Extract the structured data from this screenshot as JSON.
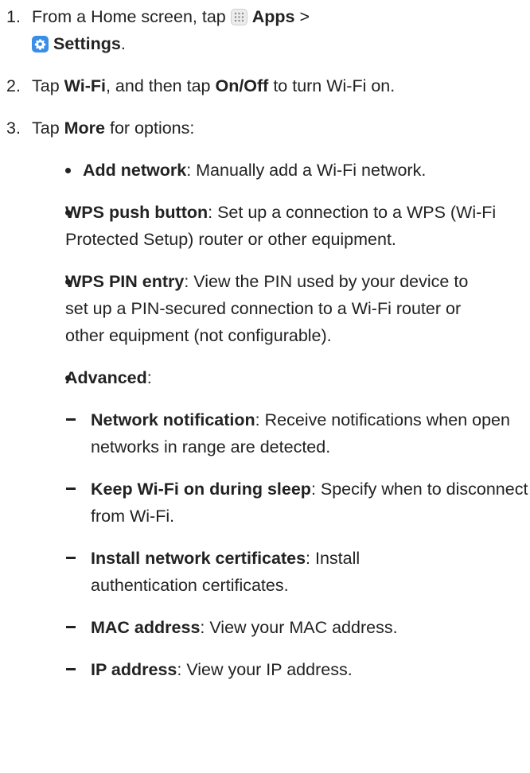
{
  "steps": [
    {
      "number": "1.",
      "text_before": "From a Home screen, tap",
      "apps_label": "Apps",
      "separator": ">",
      "settings_label": "Settings",
      "period": "."
    },
    {
      "number": "2.",
      "text_a": "Tap ",
      "bold_a": "Wi-Fi",
      "text_b": ", and then tap ",
      "bold_b": "On/Off",
      "text_c": " to turn Wi-Fi on."
    },
    {
      "number": "3.",
      "text_a": "Tap ",
      "bold_a": "More",
      "text_b": " for options:"
    }
  ],
  "options": [
    {
      "title": "Add network",
      "desc": ": Manually add a Wi-Fi network."
    },
    {
      "title": "WPS push button",
      "desc": ": Set up a connection to a WPS (Wi-Fi Protected Setup) router or other equipment."
    },
    {
      "title": "WPS PIN entry",
      "desc": ": View the PIN used by your device to set up a PIN-secured connection to a Wi-Fi router or other equipment (not configurable)."
    },
    {
      "title": "Advanced",
      "desc": ":"
    }
  ],
  "advanced": [
    {
      "title": "Network notification",
      "desc": ": Receive notifications when open networks in range are detected."
    },
    {
      "title": "Keep Wi-Fi on during sleep",
      "desc": ": Specify when to disconnect from Wi-Fi."
    },
    {
      "title": "Install network certificates",
      "desc": ": Install authentication certificates."
    },
    {
      "title": "MAC address",
      "desc": ": View your MAC address."
    },
    {
      "title": "IP address",
      "desc": ": View your IP address."
    }
  ],
  "icons": {
    "apps": "apps-grid-icon",
    "settings": "settings-gear-icon",
    "settings_color": "#3a8ee6"
  }
}
